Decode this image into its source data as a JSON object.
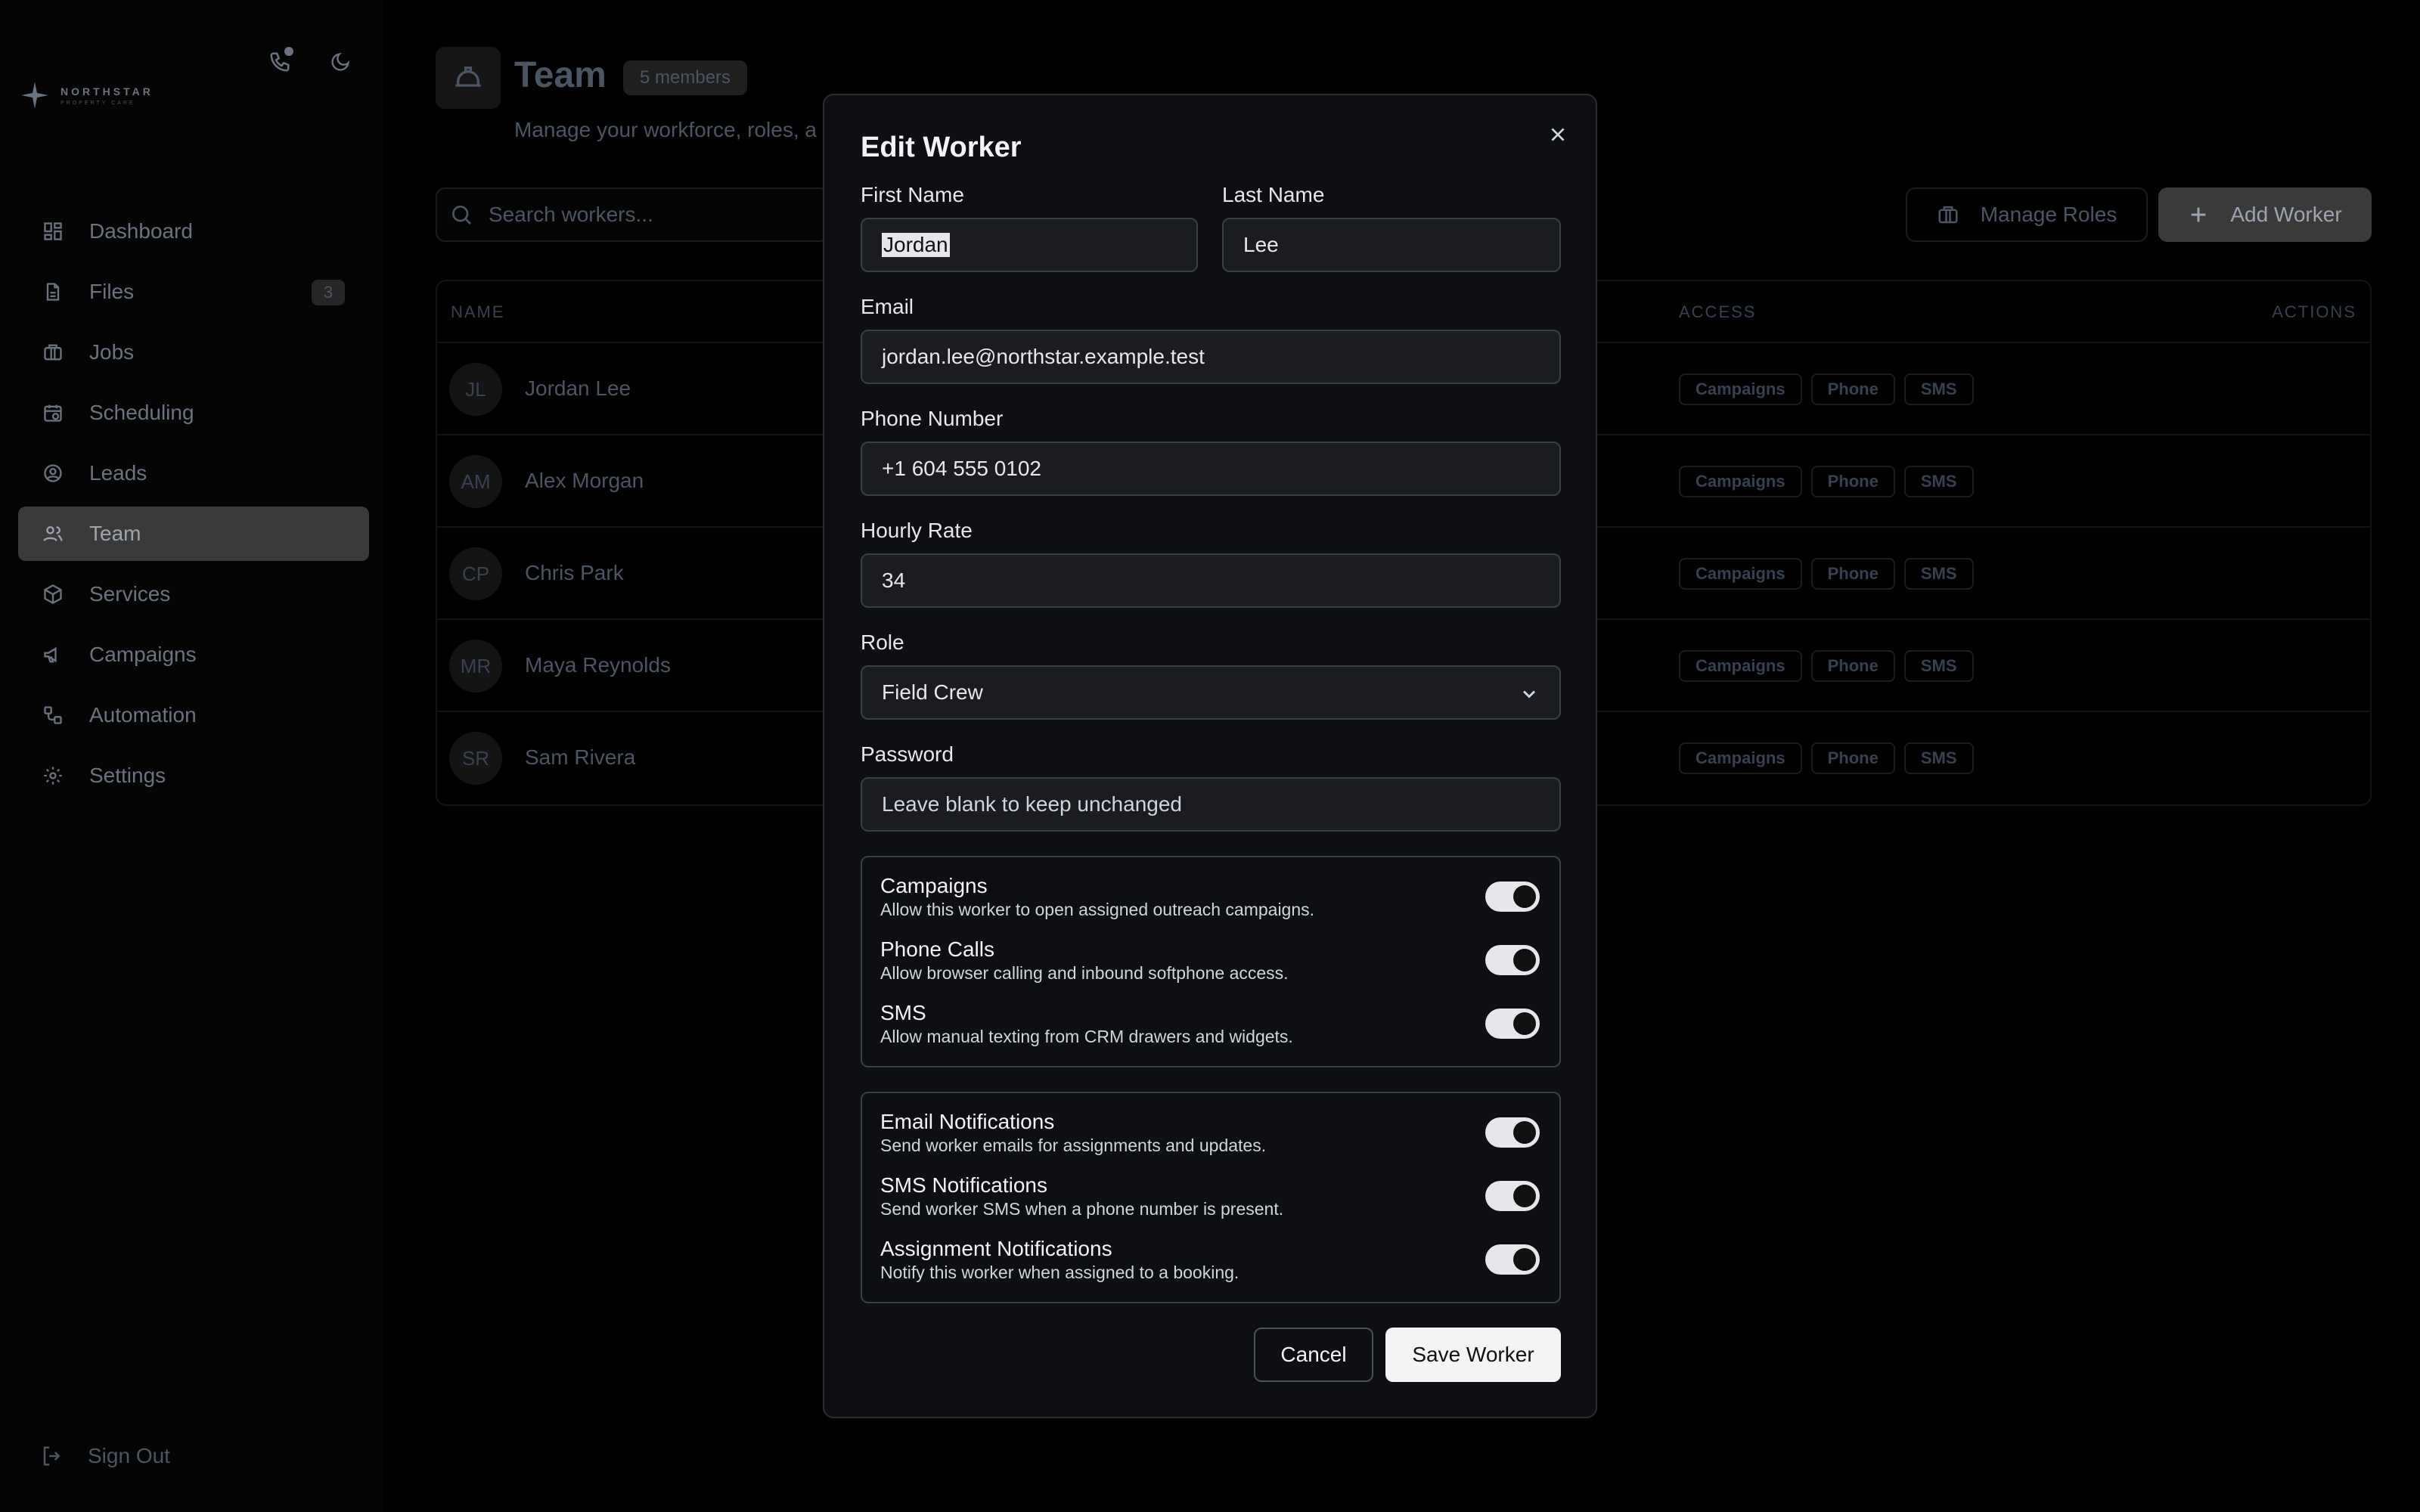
{
  "brand": {
    "name": "NORTHSTAR",
    "tagline": "PROPERTY CARE"
  },
  "sidebar": {
    "items": [
      {
        "label": "Dashboard",
        "icon": "dashboard-icon"
      },
      {
        "label": "Files",
        "icon": "file-icon",
        "badge": "3"
      },
      {
        "label": "Jobs",
        "icon": "briefcase-icon"
      },
      {
        "label": "Scheduling",
        "icon": "calendar-icon"
      },
      {
        "label": "Leads",
        "icon": "user-circle-icon"
      },
      {
        "label": "Team",
        "icon": "users-icon",
        "active": true
      },
      {
        "label": "Services",
        "icon": "box-icon"
      },
      {
        "label": "Campaigns",
        "icon": "megaphone-icon"
      },
      {
        "label": "Automation",
        "icon": "workflow-icon"
      },
      {
        "label": "Settings",
        "icon": "gear-icon"
      }
    ],
    "signout": "Sign Out"
  },
  "page": {
    "title": "Team",
    "member_badge": "5 members",
    "subtitle": "Manage your workforce, roles, a",
    "search_placeholder": "Search workers...",
    "manage_roles": "Manage Roles",
    "add_worker": "Add Worker"
  },
  "table": {
    "headers": {
      "name": "NAME",
      "access": "ACCESS",
      "actions": "ACTIONS"
    },
    "rows": [
      {
        "initials": "JL",
        "name": "Jordan Lee",
        "access": [
          "Campaigns",
          "Phone",
          "SMS"
        ]
      },
      {
        "initials": "AM",
        "name": "Alex Morgan",
        "access": [
          "Campaigns",
          "Phone",
          "SMS"
        ]
      },
      {
        "initials": "CP",
        "name": "Chris Park",
        "access": [
          "Campaigns",
          "Phone",
          "SMS"
        ]
      },
      {
        "initials": "MR",
        "name": "Maya Reynolds",
        "access": [
          "Campaigns",
          "Phone",
          "SMS"
        ]
      },
      {
        "initials": "SR",
        "name": "Sam Rivera",
        "access": [
          "Campaigns",
          "Phone",
          "SMS"
        ]
      }
    ]
  },
  "modal": {
    "title": "Edit Worker",
    "first_name": {
      "label": "First Name",
      "value": "Jordan"
    },
    "last_name": {
      "label": "Last Name",
      "value": "Lee"
    },
    "email": {
      "label": "Email",
      "value": "jordan.lee@northstar.example.test"
    },
    "phone": {
      "label": "Phone Number",
      "value": "+1 604 555 0102"
    },
    "rate": {
      "label": "Hourly Rate",
      "value": "34"
    },
    "role": {
      "label": "Role",
      "value": "Field Crew"
    },
    "password": {
      "label": "Password",
      "placeholder": "Leave blank to keep unchanged"
    },
    "access": [
      {
        "title": "Campaigns",
        "desc": "Allow this worker to open assigned outreach campaigns.",
        "on": true
      },
      {
        "title": "Phone Calls",
        "desc": "Allow browser calling and inbound softphone access.",
        "on": true
      },
      {
        "title": "SMS",
        "desc": "Allow manual texting from CRM drawers and widgets.",
        "on": true
      }
    ],
    "notifications": [
      {
        "title": "Email Notifications",
        "desc": "Send worker emails for assignments and updates.",
        "on": true
      },
      {
        "title": "SMS Notifications",
        "desc": "Send worker SMS when a phone number is present.",
        "on": true
      },
      {
        "title": "Assignment Notifications",
        "desc": "Notify this worker when assigned to a booking.",
        "on": true
      }
    ],
    "cancel": "Cancel",
    "save": "Save Worker"
  }
}
